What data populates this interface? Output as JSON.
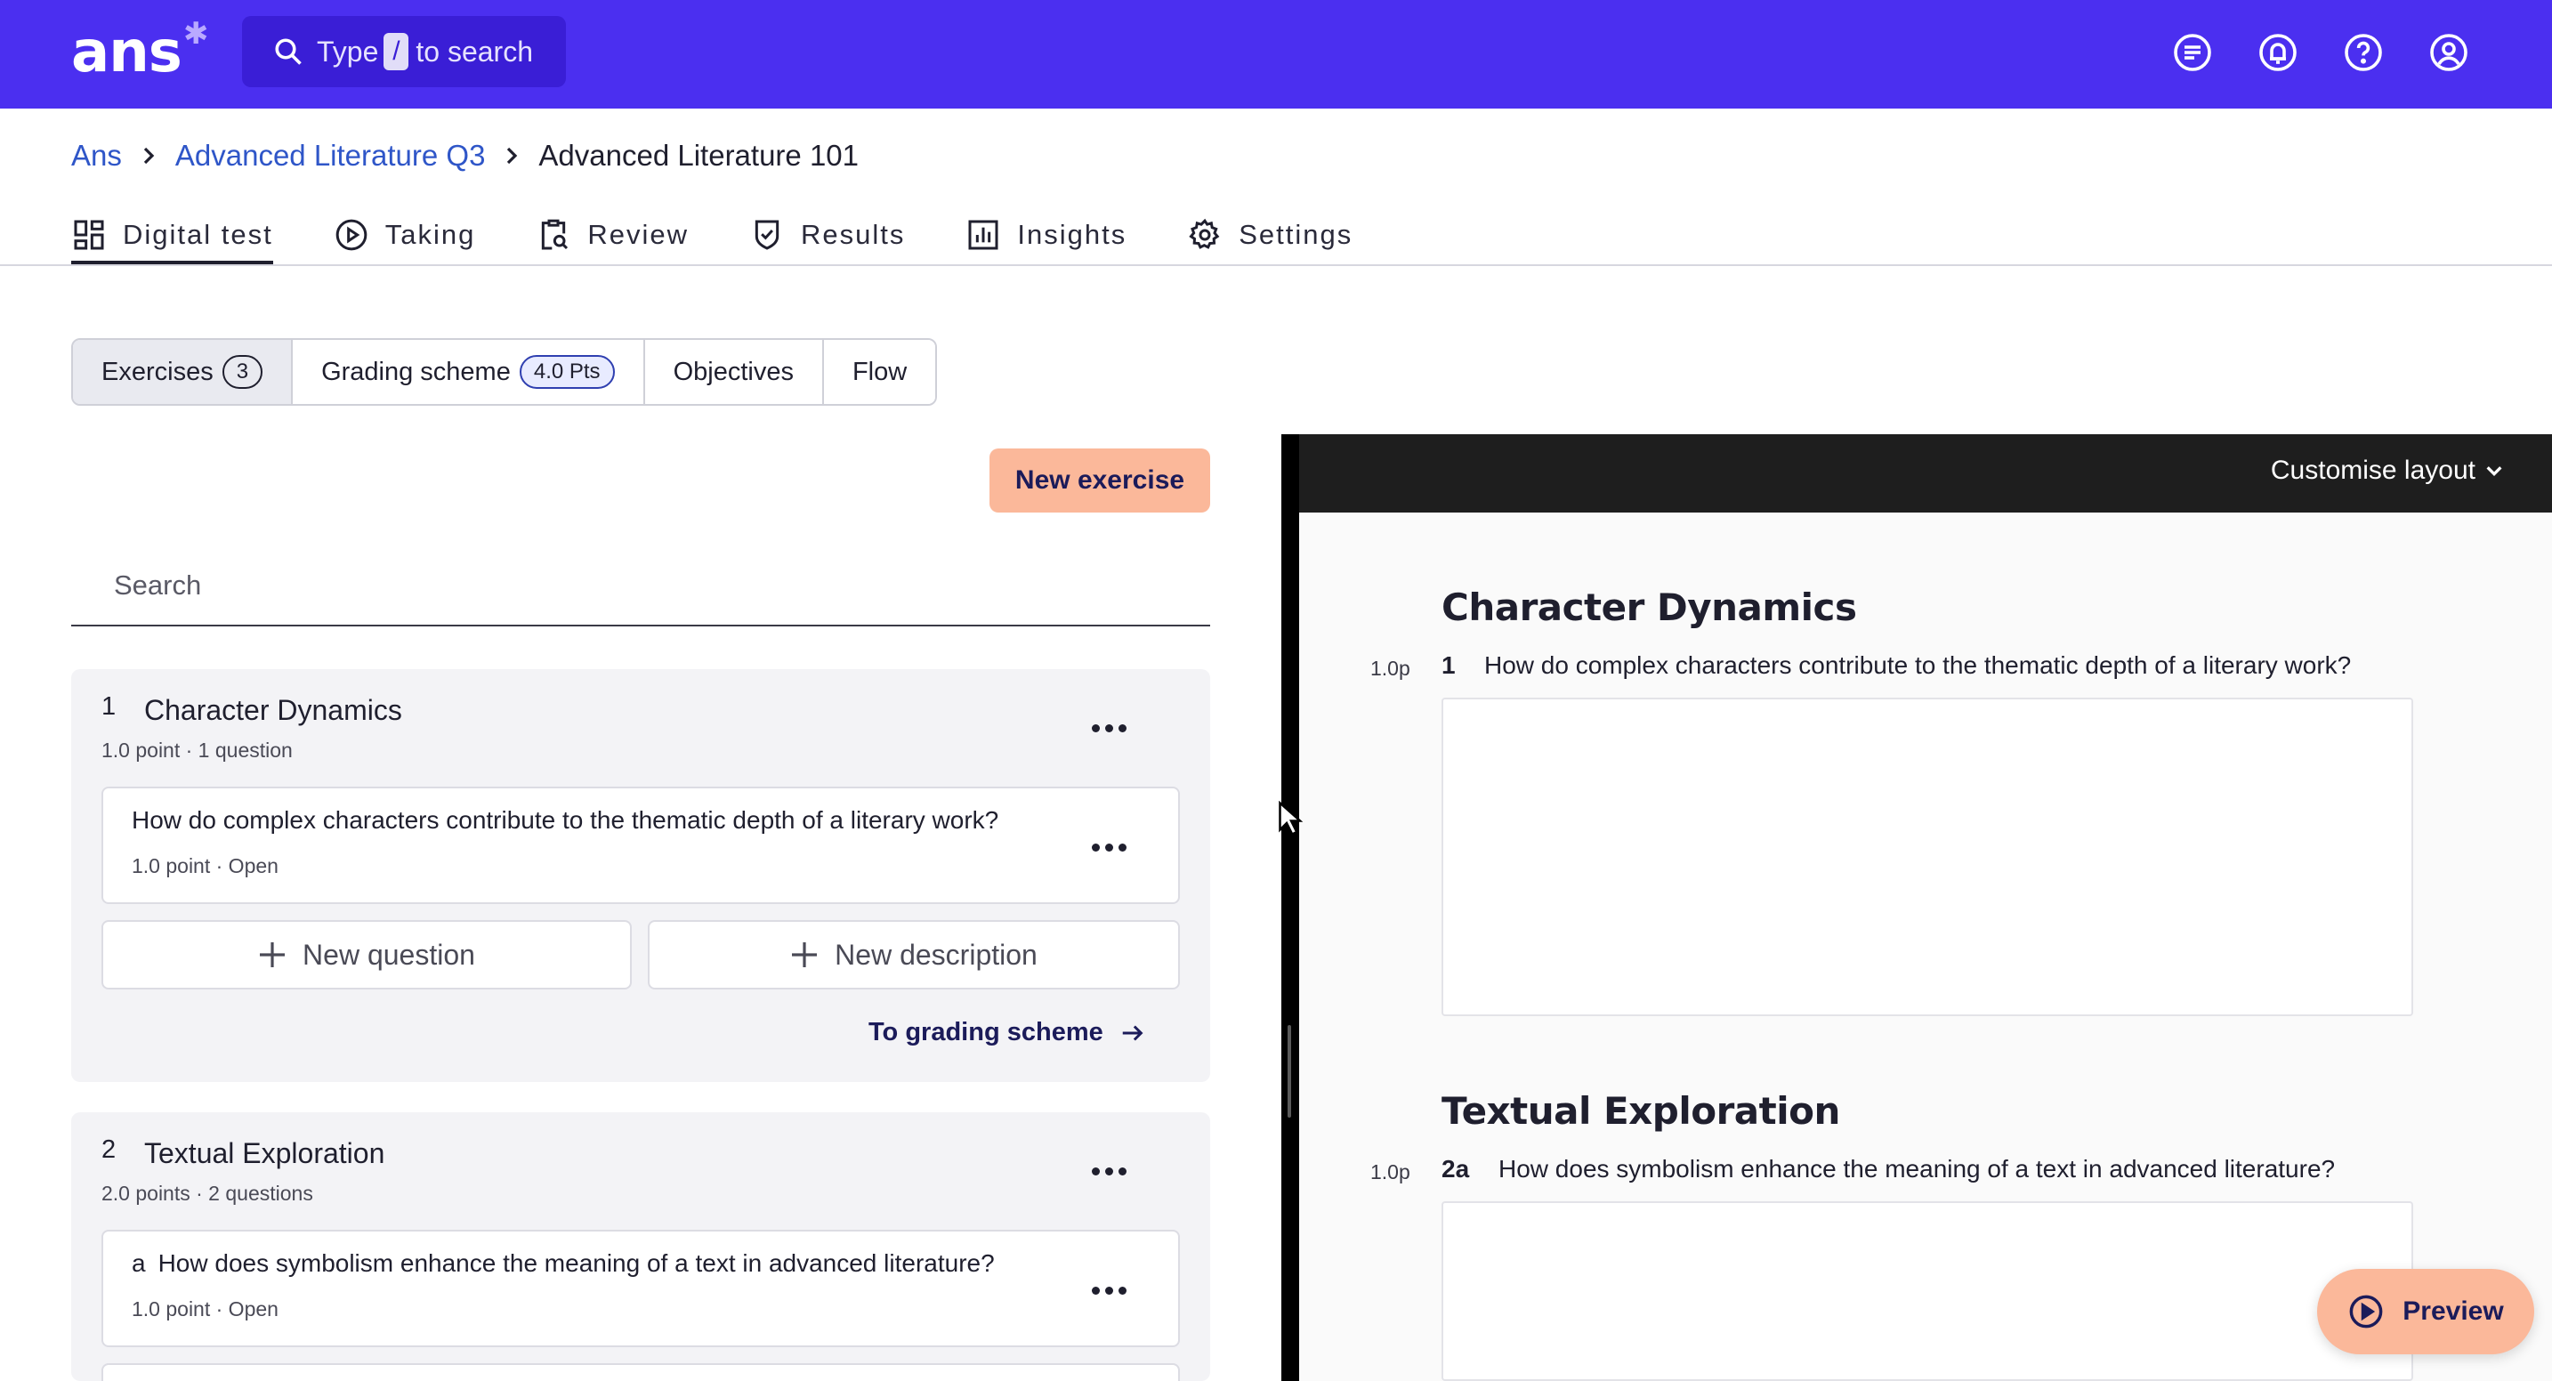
{
  "app": {
    "logo": "ans",
    "search_prefix": "Type",
    "search_key": "/",
    "search_suffix": "to search"
  },
  "topbar_icons": [
    "chat-icon",
    "bell-icon",
    "help-icon",
    "user-icon"
  ],
  "breadcrumb": {
    "root": "Ans",
    "parent": "Advanced Literature Q3",
    "current": "Advanced Literature 101"
  },
  "nav_tabs": [
    {
      "label": "Digital test",
      "icon": "grid-icon"
    },
    {
      "label": "Taking",
      "icon": "play-icon"
    },
    {
      "label": "Review",
      "icon": "clipboard-search-icon"
    },
    {
      "label": "Results",
      "icon": "shield-check-icon"
    },
    {
      "label": "Insights",
      "icon": "chart-icon"
    },
    {
      "label": "Settings",
      "icon": "gear-icon"
    }
  ],
  "sub_tabs": {
    "exercises": {
      "label": "Exercises",
      "count": "3"
    },
    "grading": {
      "label": "Grading scheme",
      "points": "4.0 Pts"
    },
    "objectives": {
      "label": "Objectives"
    },
    "flow": {
      "label": "Flow"
    }
  },
  "toolbar": {
    "new_exercise": "New exercise",
    "search_placeholder": "Search"
  },
  "exercises": [
    {
      "number": "1",
      "title": "Character Dynamics",
      "meta": "1.0 point · 1 question",
      "questions": [
        {
          "letter": "",
          "text": "How do complex characters contribute to the thematic depth of a literary work?",
          "meta": "1.0 point · Open"
        }
      ],
      "new_question": "New question",
      "new_description": "New description",
      "to_grading": "To grading scheme"
    },
    {
      "number": "2",
      "title": "Textual Exploration",
      "meta": "2.0 points · 2 questions",
      "questions": [
        {
          "letter": "a",
          "text": "How does symbolism enhance the meaning of a text in advanced literature?",
          "meta": "1.0 point · Open"
        }
      ]
    }
  ],
  "preview_panel": {
    "customise": "Customise layout",
    "sections": [
      {
        "title": "Character Dynamics",
        "points": "1.0p",
        "qnum": "1",
        "question": "How do complex characters contribute to the thematic depth of a literary work?"
      },
      {
        "title": "Textual Exploration",
        "points": "1.0p",
        "qnum": "2a",
        "question": "How does symbolism enhance the meaning of a text in advanced literature?"
      }
    ],
    "preview_button": "Preview"
  },
  "colors": {
    "brand": "#4b2ff0",
    "accent": "#fbb89a",
    "link": "#2f56c8"
  }
}
